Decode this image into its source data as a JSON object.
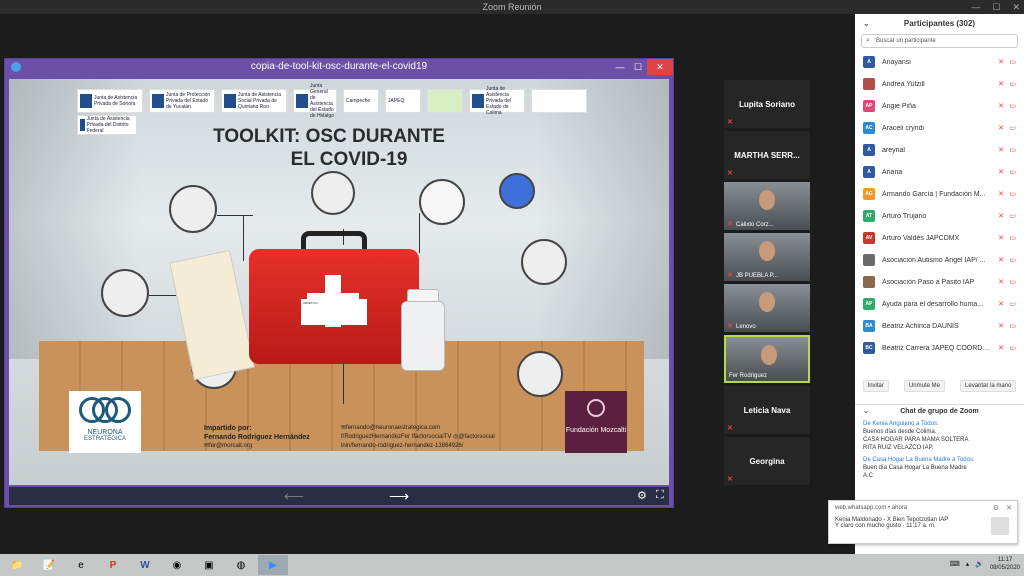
{
  "window": {
    "title": "Zoom Reunión"
  },
  "share": {
    "title": "copia-de-tool-kit-osc-durante-el-covid19",
    "slide_title_line1": "TOOLKIT: OSC DURANTE",
    "slide_title_line2": "EL COVID-19",
    "logos": [
      "Junta de Asistencia Privada de Sonora",
      "Junta de Protección Privada del Estado de Yucatán",
      "Junta de Asistencia Social Privada de Quintana Roo",
      "Junta General de Asistencia del Estado de Hidalgo",
      "Campeche",
      "JAPEQ",
      "",
      "Junta de Asistencia Privada del Estado de Colima",
      ""
    ],
    "logo_extra": "Junta de Asistencia Privada del Distrito Federal",
    "kit_label": "OBJETIVO",
    "neurona_line1": "NEURONA",
    "neurona_line2": "ESTRATÉGICA",
    "mozcalti": "Fundación Mozcalti",
    "credits_label": "Impartido por:",
    "credits_name": "Fernando Rodríguez Hernández",
    "credits_email": "fer@morcalt.org",
    "contact_email": "fernando@neuronaestrategica.com",
    "contact_fb": "/RodriguezHernandezFer",
    "contact_tw": "factorsocialTV",
    "contact_ig": "@factorsocial",
    "contact_in": "in/fernando-rodriguez-hernandez-13864926/"
  },
  "tiles": [
    {
      "name": "Lupita Soriano",
      "video": false
    },
    {
      "name": "MARTHA SERR...",
      "video": false
    },
    {
      "name": "Calixto Corz...",
      "video": true
    },
    {
      "name": "JB PUEBLA P...",
      "video": true
    },
    {
      "name": "Lenovo",
      "video": true
    },
    {
      "name": "Fer Rodriguez",
      "video": true
    },
    {
      "name": "Leticia Nava",
      "video": false
    },
    {
      "name": "Georgina",
      "video": false
    }
  ],
  "participants": {
    "title": "Participantes (302)",
    "search_placeholder": "Buscar un participante",
    "list": [
      {
        "initials": "A",
        "name": "Anayansi",
        "color": "#2d5aa0"
      },
      {
        "initials": "",
        "name": "Andrea Yutzill",
        "color": "#b0504a"
      },
      {
        "initials": "AP",
        "name": "Angie Piña",
        "color": "#e0457b"
      },
      {
        "initials": "AC",
        "name": "Araceli cryndi",
        "color": "#2a8ad4"
      },
      {
        "initials": "A",
        "name": "areynal",
        "color": "#2d5aa0"
      },
      {
        "initials": "A",
        "name": "Ariana",
        "color": "#2d5aa0"
      },
      {
        "initials": "AG",
        "name": "Armando García | Fundación M...",
        "color": "#f09a2a"
      },
      {
        "initials": "AT",
        "name": "Arturo Trujano",
        "color": "#2faa6a"
      },
      {
        "initials": "AV",
        "name": "Arturo Valdés JAPCDMX",
        "color": "#c0392b"
      },
      {
        "initials": "",
        "name": "Asociación Autismo Ángel IAP/ ...",
        "color": "#6a6a6a"
      },
      {
        "initials": "",
        "name": "Asociación Paso a Pasito IAP",
        "color": "#8a6a4a"
      },
      {
        "initials": "AP",
        "name": "Ayuda para el desarrollo huma...",
        "color": "#2faa6a"
      },
      {
        "initials": "BA",
        "name": "Beatriz Achirica DAUNIS",
        "color": "#2a8ad4"
      },
      {
        "initials": "BC",
        "name": "Beatriz Carrera JAPEQ COORDI...",
        "color": "#2d5aa0"
      }
    ],
    "btn_invite": "Invitar",
    "btn_unmute": "Unmute Me",
    "btn_raise": "Levantar la mano"
  },
  "chat": {
    "title": "Chat de grupo de Zoom",
    "messages": [
      {
        "from": "De Kenia Anguiano a Todos:",
        "lines": [
          "Buenos días desde Colima.",
          "CASA HOGAR PARA MAMA SOLTERA",
          "RITA RUIZ VELAZCO IAP."
        ]
      },
      {
        "from": "De Casa Hogar La Buena Madre a Todos:",
        "lines": [
          "Buen día Casa Hogar La Buena Madre",
          "A.C"
        ]
      }
    ]
  },
  "notification": {
    "source": "web.whatsapp.com • ahora",
    "title": "Kenia Maldonado - X Bien Tepotzotlan IAP",
    "body": "Y claro con mucho gusto · 11:17 a. m."
  },
  "taskbar": {
    "time": "11:17",
    "date": "08/05/2020"
  }
}
